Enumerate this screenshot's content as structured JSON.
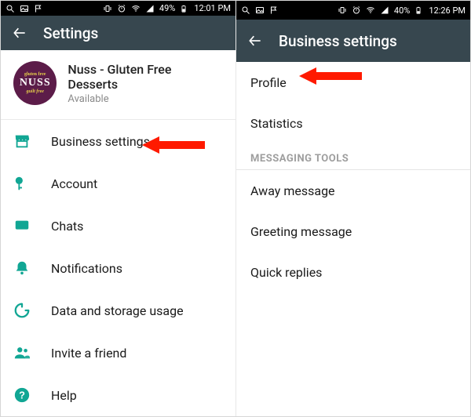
{
  "left": {
    "status": {
      "battery": "49%",
      "time": "12:01 PM"
    },
    "header": {
      "title": "Settings"
    },
    "profile": {
      "name": "Nuss - Gluten Free Desserts",
      "status": "Available",
      "avatar_top": "gluten free",
      "avatar_mid": "NUSS",
      "avatar_bot": "guilt free"
    },
    "items": [
      {
        "icon": "storefront-icon",
        "label": "Business settings"
      },
      {
        "icon": "key-icon",
        "label": "Account"
      },
      {
        "icon": "chat-icon",
        "label": "Chats"
      },
      {
        "icon": "bell-icon",
        "label": "Notifications"
      },
      {
        "icon": "data-icon",
        "label": "Data and storage usage"
      },
      {
        "icon": "people-icon",
        "label": "Invite a friend"
      },
      {
        "icon": "help-icon",
        "label": "Help"
      }
    ]
  },
  "right": {
    "status": {
      "battery": "40%",
      "time": "12:26 PM"
    },
    "header": {
      "title": "Business settings"
    },
    "items": [
      {
        "label": "Profile"
      },
      {
        "label": "Statistics"
      }
    ],
    "section_header": "MESSAGING TOOLS",
    "tools": [
      {
        "label": "Away message"
      },
      {
        "label": "Greeting message"
      },
      {
        "label": "Quick replies"
      }
    ]
  }
}
